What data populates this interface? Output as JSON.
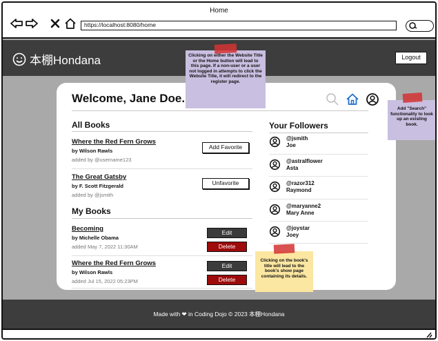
{
  "browser": {
    "window_title": "Home",
    "url": "https://localhost:8080/home"
  },
  "app": {
    "brand": "本棚Hondana",
    "logout_label": "Logout"
  },
  "welcome": "Welcome, Jane Doe.",
  "all_books": {
    "heading": "All Books",
    "items": [
      {
        "title": "Where the Red Fern Grows",
        "author": "by Wilson Rawls",
        "added": "added by @username123",
        "action": "Add Favorite"
      },
      {
        "title": "The Great Gatsby",
        "author": "by F. Scott Fitzgerald",
        "added": "added by @jsmith",
        "action": "Unfavorite"
      }
    ]
  },
  "my_books": {
    "heading": "My Books",
    "edit_label": "Edit",
    "delete_label": "Delete",
    "items": [
      {
        "title": "Becoming",
        "author": "by Michelle Obama",
        "added": "added May 7, 2022 11:30AM"
      },
      {
        "title": "Where the Red Fern Grows",
        "author": "by Wilson Rawls",
        "added": "added Jul 15, 2022 05:23PM"
      }
    ]
  },
  "followers": {
    "heading": "Your Followers",
    "items": [
      {
        "handle": "@jsmith",
        "name": "Joe"
      },
      {
        "handle": "@astralflower",
        "name": "Asta"
      },
      {
        "handle": "@razor312",
        "name": "Raymond"
      },
      {
        "handle": "@maryanne2",
        "name": "Mary Anne"
      },
      {
        "handle": "@joystar",
        "name": "Joey"
      }
    ]
  },
  "footer": "Made with ❤ in Coding Dojo © 2023 本棚Hondana",
  "notes": {
    "title_note": "Clicking on either the Website Title or the Home button will lead to this page. If a non-user or a user not logged in attempts to click the Website Title, it will redirect to the register page.",
    "search_note": "Add \"Search\" functionality to look up an existing book.",
    "book_note": "Clicking on the book's title will lead to the book's show page containing its details."
  },
  "colors": {
    "header_bg": "#3d3d3d",
    "page_bg": "#a9a9a9",
    "delete_bg": "#9e0b0b",
    "edit_bg": "#3b3b3b",
    "home_icon": "#1f6fd1",
    "note_purple": "#c9bfe0",
    "note_yellow": "#fbe7a1"
  }
}
